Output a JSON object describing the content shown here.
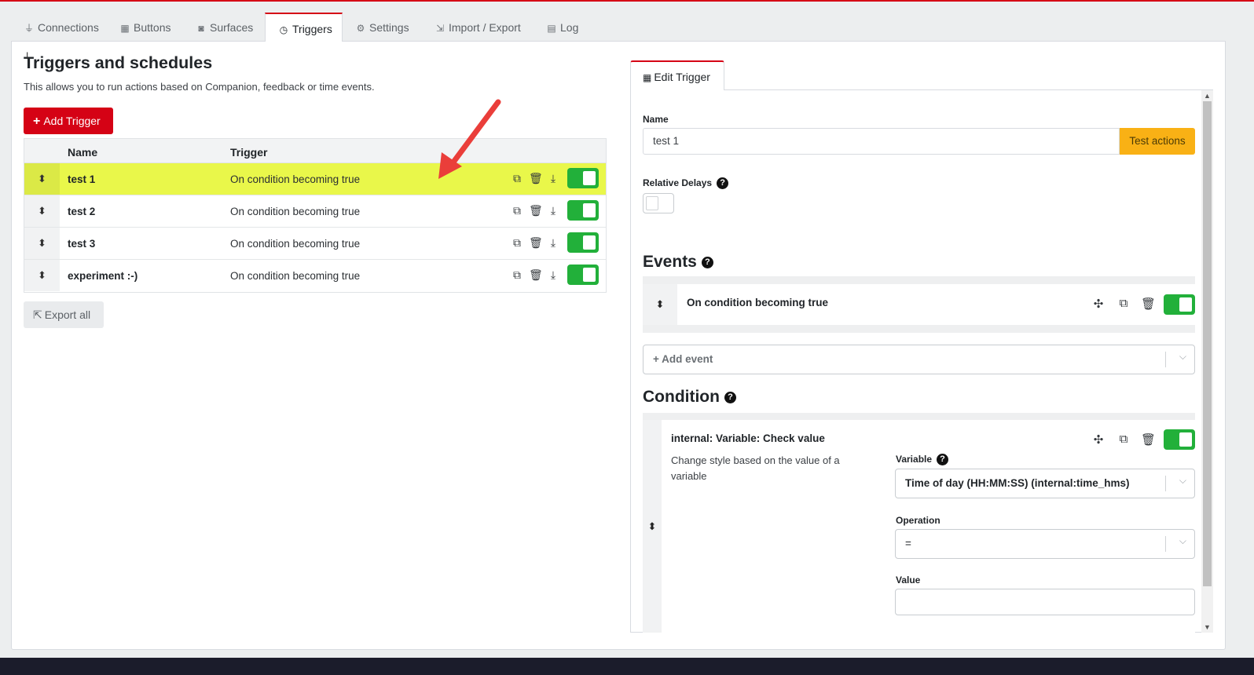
{
  "tabs": [
    {
      "icon": "plug-icon",
      "glyph": "⏚",
      "label": "Connections"
    },
    {
      "icon": "calendar-icon",
      "glyph": "▦",
      "label": "Buttons"
    },
    {
      "icon": "gamepad-icon",
      "glyph": "◙",
      "label": "Surfaces"
    },
    {
      "icon": "clock-icon",
      "glyph": "◷",
      "label": "Triggers",
      "active": true
    },
    {
      "icon": "gear-icon",
      "glyph": "⚙",
      "label": "Settings"
    },
    {
      "icon": "file-import-icon",
      "glyph": "⇲",
      "label": "Import / Export"
    },
    {
      "icon": "clipboard-icon",
      "glyph": "▤",
      "label": "Log"
    }
  ],
  "page": {
    "title": "Triggers and schedules",
    "description": "This allows you to run actions based on Companion, feedback or time events.",
    "add_trigger": "Add Trigger",
    "export_all": "Export all"
  },
  "table": {
    "headers": {
      "name": "Name",
      "trigger": "Trigger"
    },
    "rows": [
      {
        "name": "test 1",
        "trigger": "On condition becoming true",
        "enabled": true,
        "highlighted": true
      },
      {
        "name": "test 2",
        "trigger": "On condition becoming true",
        "enabled": true
      },
      {
        "name": "test 3",
        "trigger": "On condition becoming true",
        "enabled": true
      },
      {
        "name": "experiment :-)",
        "trigger": "On condition becoming true",
        "enabled": true
      }
    ]
  },
  "editor": {
    "tab_label": "Edit Trigger",
    "name_label": "Name",
    "name_value": "test 1",
    "test_actions": "Test actions",
    "relative_delays_label": "Relative Delays",
    "relative_delays_enabled": false,
    "events_heading": "Events",
    "event_item": "On condition becoming true",
    "add_event_placeholder": "+ Add event",
    "condition_heading": "Condition",
    "condition": {
      "title": "internal: Variable: Check value",
      "description": "Change style based on the value of a variable",
      "variable_label": "Variable",
      "variable_value": "Time of day (HH:MM:SS) (internal:time_hms)",
      "operation_label": "Operation",
      "operation_value": "=",
      "value_label": "Value",
      "value_value": ""
    }
  },
  "colors": {
    "accent": "#d50215",
    "success": "#22b03a",
    "warning": "#f9b115",
    "highlight": "#e9f74a"
  }
}
